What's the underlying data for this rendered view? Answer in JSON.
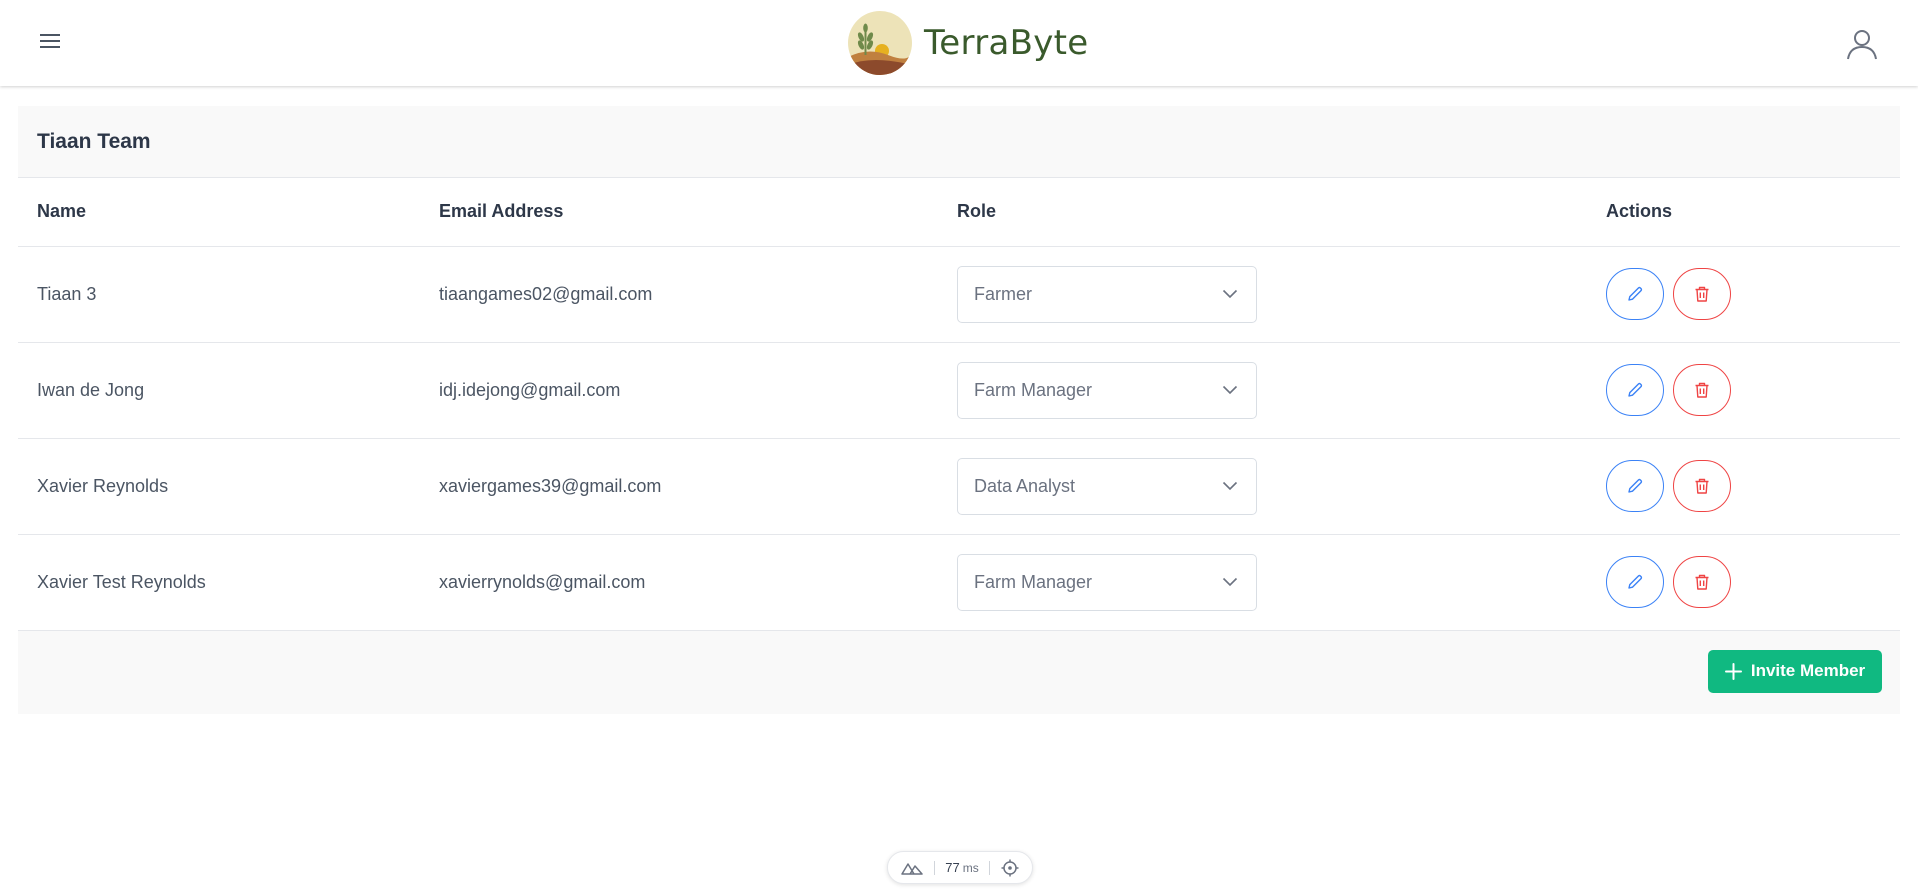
{
  "header": {
    "brand_name": "TerraByte",
    "menu_icon": "hamburger-menu-icon",
    "user_icon": "user-icon",
    "brand_color": "#3a5a2c"
  },
  "team": {
    "title": "Tiaan Team",
    "columns": [
      "Name",
      "Email Address",
      "Role",
      "Actions"
    ],
    "members": [
      {
        "name": "Tiaan 3",
        "email": "tiaangames02@gmail.com",
        "role": "Farmer"
      },
      {
        "name": "Iwan de Jong",
        "email": "idj.idejong@gmail.com",
        "role": "Farm Manager"
      },
      {
        "name": "Xavier Reynolds",
        "email": "xaviergames39@gmail.com",
        "role": "Data Analyst"
      },
      {
        "name": "Xavier Test Reynolds",
        "email": "xavierrynolds@gmail.com",
        "role": "Farm Manager"
      }
    ],
    "invite_label": "Invite Member",
    "colors": {
      "edit": "#3b82f6",
      "delete": "#ef4444",
      "invite": "#10b981"
    }
  },
  "devbar": {
    "time_value": "77",
    "time_unit": "ms"
  }
}
